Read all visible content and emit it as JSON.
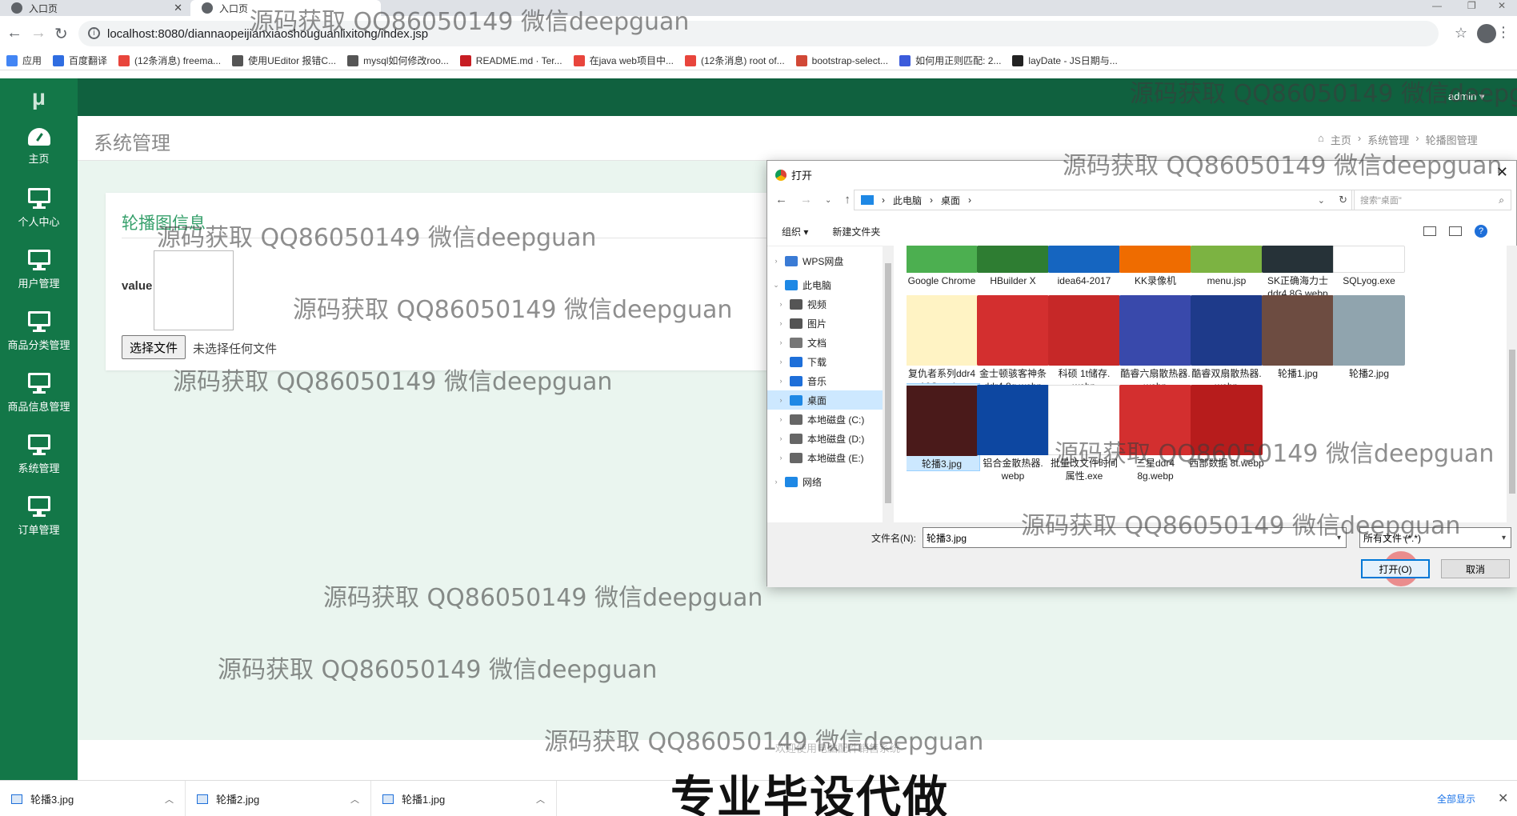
{
  "browser": {
    "tabs": [
      {
        "label": "入口页",
        "active": false
      },
      {
        "label": "入口页",
        "active": true
      }
    ],
    "url": "localhost:8080/diannaopeijianxiaoshouguanlixitong/index.jsp",
    "bookmarks": [
      {
        "label": "应用",
        "color": "#4285f4"
      },
      {
        "label": "百度翻译",
        "color": "#2f6de1"
      },
      {
        "label": "(12条消息) freema...",
        "color": "#e8453c"
      },
      {
        "label": "使用UEditor 报错C...",
        "color": "#555555"
      },
      {
        "label": "mysql如何修改roo...",
        "color": "#555555"
      },
      {
        "label": "README.md · Ter...",
        "color": "#c71d23"
      },
      {
        "label": "在java web项目中...",
        "color": "#e8453c"
      },
      {
        "label": "(12条消息) root of...",
        "color": "#e8453c"
      },
      {
        "label": "bootstrap-select...",
        "color": "#d14836"
      },
      {
        "label": "如何用正则匹配: 2...",
        "color": "#3b5bdb"
      },
      {
        "label": "layDate - JS日期与...",
        "color": "#222222"
      }
    ]
  },
  "app": {
    "logo": "μ",
    "user": "admin ▾",
    "sidebar": [
      {
        "label": "主页",
        "icon": "dashboard-icon"
      },
      {
        "label": "个人中心",
        "icon": "monitor-icon"
      },
      {
        "label": "用户管理",
        "icon": "monitor-icon"
      },
      {
        "label": "商品分类管理",
        "icon": "monitor-icon"
      },
      {
        "label": "商品信息管理",
        "icon": "monitor-icon"
      },
      {
        "label": "系统管理",
        "icon": "monitor-icon"
      },
      {
        "label": "订单管理",
        "icon": "monitor-icon"
      }
    ],
    "page_title": "系统管理",
    "breadcrumb": [
      "主页",
      "系统管理",
      "轮播图管理"
    ],
    "card": {
      "title": "轮播图信息",
      "field_label": "value",
      "file_button": "选择文件",
      "file_status": "未选择任何文件"
    },
    "footer": "欢迎使用电脑配件销售系统"
  },
  "dialog": {
    "title": "打开",
    "path": [
      "此电脑",
      "桌面"
    ],
    "search_placeholder": "搜索\"桌面\"",
    "toolbar": {
      "organize": "组织 ▾",
      "new_folder": "新建文件夹"
    },
    "tree": [
      {
        "label": "WPS网盘",
        "level": 1,
        "color": "#3a7bd5"
      },
      {
        "label": "此电脑",
        "level": 1,
        "color": "#1e88e5",
        "expanded": true
      },
      {
        "label": "视频",
        "level": 2,
        "color": "#555555"
      },
      {
        "label": "图片",
        "level": 2,
        "color": "#555555"
      },
      {
        "label": "文档",
        "level": 2,
        "color": "#777777"
      },
      {
        "label": "下载",
        "level": 2,
        "color": "#1e6fd9"
      },
      {
        "label": "音乐",
        "level": 2,
        "color": "#1e6fd9"
      },
      {
        "label": "桌面",
        "level": 2,
        "color": "#1e88e5",
        "selected": true
      },
      {
        "label": "本地磁盘 (C:)",
        "level": 2,
        "color": "#666666"
      },
      {
        "label": "本地磁盘 (D:)",
        "level": 2,
        "color": "#666666"
      },
      {
        "label": "本地磁盘 (E:)",
        "level": 2,
        "color": "#666666"
      },
      {
        "label": "网络",
        "level": 1,
        "color": "#1e88e5"
      }
    ],
    "files_row1": [
      "Google Chrome",
      "HBuilder X",
      "idea64-2017",
      "KK录像机",
      "menu.jsp",
      "SK正确海力士 ddr4 8G.webp",
      "SQLyog.exe"
    ],
    "files_row2": [
      "复仇者系列ddr4 16G.webp",
      "金士顿骇客神条 ddr4 8g.webp",
      "科硕 1t储存. webp",
      "酷睿六扇散热器. webp",
      "酷睿双扇散热器. webp",
      "轮播1.jpg",
      "轮播2.jpg"
    ],
    "files_row3": [
      "轮播3.jpg",
      "铝合金散热器. webp",
      "批量改文件时间 属性.exe",
      "三星ddr4 8g.webp",
      "西部数据 8t.webp"
    ],
    "thumb_colors": {
      "row1": [
        "#4caf50",
        "#2e7d32",
        "#1565c0",
        "#ef6c00",
        "#7cb342",
        "#263238",
        "#ffffff"
      ],
      "row2": [
        "#fff3c4",
        "#d32f2f",
        "#c62828",
        "#3949ab",
        "#1e3a8a",
        "#6d4c41",
        "#90a4ae"
      ],
      "row3": [
        "#4a1a1a",
        "#0d47a1",
        "#ffffff",
        "#d32f2f",
        "#b71c1c"
      ]
    },
    "filename_label": "文件名(N):",
    "filename_value": "轮播3.jpg",
    "filetype": "所有文件 (*.*)",
    "open_button": "打开(O)",
    "cancel_button": "取消"
  },
  "downloads": {
    "items": [
      "轮播3.jpg",
      "轮播2.jpg",
      "轮播1.jpg"
    ],
    "show_all": "全部显示"
  },
  "overlay": {
    "watermark": "源码获取 QQ86050149 微信deepguan",
    "subtitle": "专业毕设代做"
  }
}
